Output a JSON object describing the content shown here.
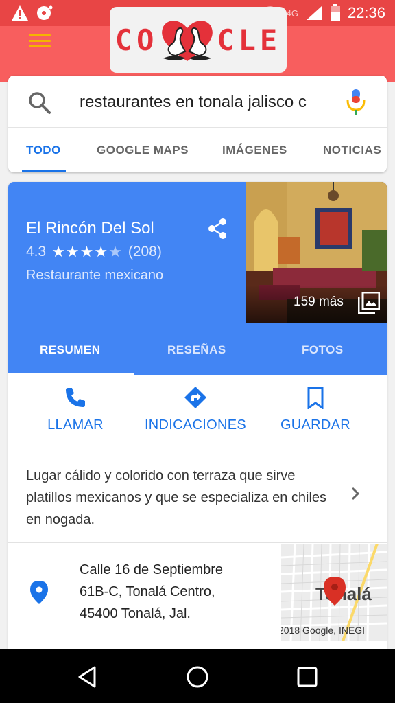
{
  "status_bar": {
    "network_label": "4G",
    "time": "22:36"
  },
  "doodle": {
    "text_left": "CO",
    "text_right": "CLE"
  },
  "search": {
    "query": "restaurantes en tonala jalisco c"
  },
  "search_tabs": [
    {
      "label": "TODO"
    },
    {
      "label": "GOOGLE MAPS"
    },
    {
      "label": "IMÁGENES"
    },
    {
      "label": "NOTICIAS"
    }
  ],
  "place": {
    "name": "El Rincón Del Sol",
    "rating": "4.3",
    "stars": "★★★★",
    "half_star": "★",
    "review_count": "(208)",
    "category": "Restaurante mexicano",
    "photo_count_label": "159 más"
  },
  "place_tabs": [
    {
      "label": "RESUMEN"
    },
    {
      "label": "RESEÑAS"
    },
    {
      "label": "FOTOS"
    }
  ],
  "actions": [
    {
      "label": "LLAMAR",
      "icon": "phone-icon"
    },
    {
      "label": "INDICACIONES",
      "icon": "directions-icon"
    },
    {
      "label": "GUARDAR",
      "icon": "bookmark-icon"
    }
  ],
  "description": "Lugar cálido y colorido con terraza que sirve platillos mexicanos y que se especializa en chiles en nogada.",
  "address": {
    "line1": "Calle 16 de Septiembre",
    "line2": "61B-C, Tonalá Centro,",
    "line3": "45400 Tonalá, Jal."
  },
  "map": {
    "city_label": "Tonalá",
    "copyright": "2018 Google, INEGI"
  },
  "colors": {
    "header_red": "#f85e5e",
    "google_blue": "#4285f4",
    "link_blue": "#1a73e8",
    "pin_red": "#d93025"
  }
}
